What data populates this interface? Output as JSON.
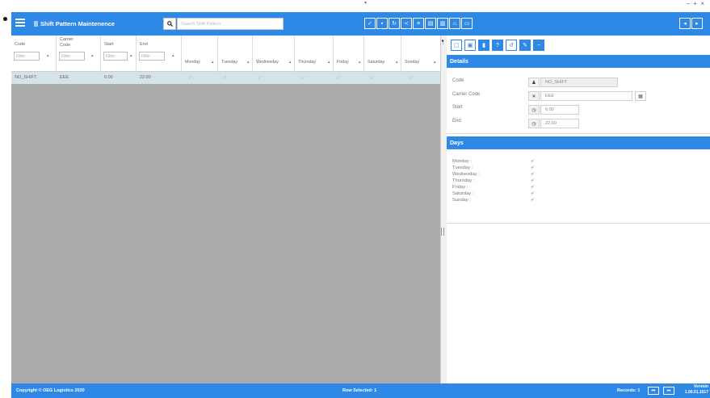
{
  "window": {
    "controls": "– + ×",
    "top_caret": "▾"
  },
  "header": {
    "title": "Shift Pattern Maintenence",
    "search": {
      "placeholder": "Search Shift Pattern",
      "value": ""
    },
    "toolbar_icons": [
      "check-icon",
      "save-icon",
      "refresh-icon",
      "share-icon",
      "list-icon",
      "document-icon",
      "document-alt-icon",
      "home-icon",
      "window-icon"
    ],
    "right_icons": [
      "back-icon",
      "forward-icon"
    ]
  },
  "grid": {
    "columns": [
      {
        "label": "Code",
        "filter_placeholder": "Filter"
      },
      {
        "label": "Carrier Code",
        "filter_placeholder": "Filter"
      },
      {
        "label": "Start",
        "filter_placeholder": "Filter"
      },
      {
        "label": "End",
        "filter_placeholder": "Filter"
      }
    ],
    "day_columns": [
      "Monday",
      "Tuesday",
      "Wednesday",
      "Thursday",
      "Friday",
      "Saturday",
      "Sunday"
    ],
    "rows": [
      {
        "code": "NO_SHIFT",
        "carrier_code": "EEE",
        "start": "6:00",
        "end": "22:00",
        "days": [
          "✓",
          "✓",
          "✓",
          "✓",
          "✓",
          "✓",
          "✓"
        ]
      }
    ]
  },
  "details": {
    "header": "Details",
    "toolbar_icons": [
      "new-icon",
      "copy-icon",
      "delete-icon",
      "help-icon",
      "undo-icon",
      "edit-icon",
      "minus-icon"
    ],
    "fields": {
      "code": {
        "label": "Code",
        "value": "NO_SHIFT",
        "icon": "user-icon"
      },
      "carrier_code": {
        "label": "Carrier Code",
        "value": "EEE",
        "icon": "tools-icon"
      },
      "start": {
        "label": "Start",
        "value": "6:00",
        "icon": "clock-icon"
      },
      "end": {
        "label": "End",
        "value": "22:00",
        "icon": "clock-icon"
      }
    }
  },
  "days": {
    "header": "Days",
    "items": [
      {
        "label": "Monday :",
        "checked": "✓"
      },
      {
        "label": "Tuesday :",
        "checked": "✓"
      },
      {
        "label": "Wednesday :",
        "checked": "✓"
      },
      {
        "label": "Thursday :",
        "checked": "✓"
      },
      {
        "label": "Friday :",
        "checked": "✓"
      },
      {
        "label": "Saturday :",
        "checked": "✓"
      },
      {
        "label": "Sunday :",
        "checked": "✓"
      }
    ]
  },
  "footer": {
    "copyright": "Copyright © OEG Logistics 2020",
    "row_selected": "Row Selected: 1",
    "records": "Records: 1",
    "version_label": "Version",
    "version_number": "1.00.01.1017"
  },
  "colors": {
    "accent": "#2e88e5",
    "grid_background": "#ababab",
    "selected_row": "#d4e3e6"
  }
}
